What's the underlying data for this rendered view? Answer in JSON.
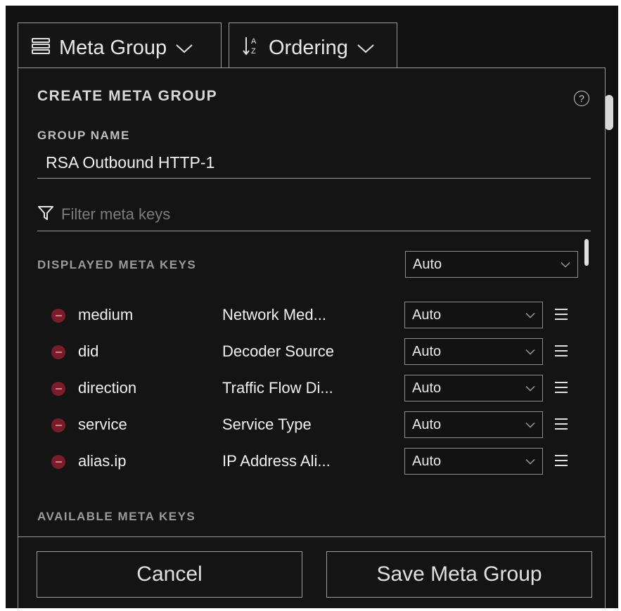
{
  "toolbar": {
    "meta_group_label": "Meta Group",
    "ordering_label": "Ordering"
  },
  "panel": {
    "title": "CREATE META GROUP",
    "help_glyph": "?",
    "group_name_label": "GROUP NAME",
    "group_name_value": "RSA Outbound HTTP-1",
    "filter_placeholder": "Filter meta keys",
    "displayed_label": "DISPLAYED META KEYS",
    "displayed_select": "Auto",
    "available_label": "AVAILABLE META KEYS"
  },
  "meta_keys": [
    {
      "key": "medium",
      "description": "Network Med...",
      "mode": "Auto"
    },
    {
      "key": "did",
      "description": "Decoder Source",
      "mode": "Auto"
    },
    {
      "key": "direction",
      "description": "Traffic Flow Di...",
      "mode": "Auto"
    },
    {
      "key": "service",
      "description": "Service Type",
      "mode": "Auto"
    },
    {
      "key": "alias.ip",
      "description": "IP Address Ali...",
      "mode": "Auto"
    }
  ],
  "footer": {
    "cancel_label": "Cancel",
    "save_label": "Save Meta Group"
  },
  "colors": {
    "background": "#111111",
    "border": "#9a9a9a",
    "remove_icon": "#7a1c2a"
  },
  "icons": [
    "list-icon",
    "sort-az-icon",
    "chevron-down-icon",
    "help-icon",
    "filter-icon",
    "remove-icon",
    "drag-handle-icon"
  ]
}
